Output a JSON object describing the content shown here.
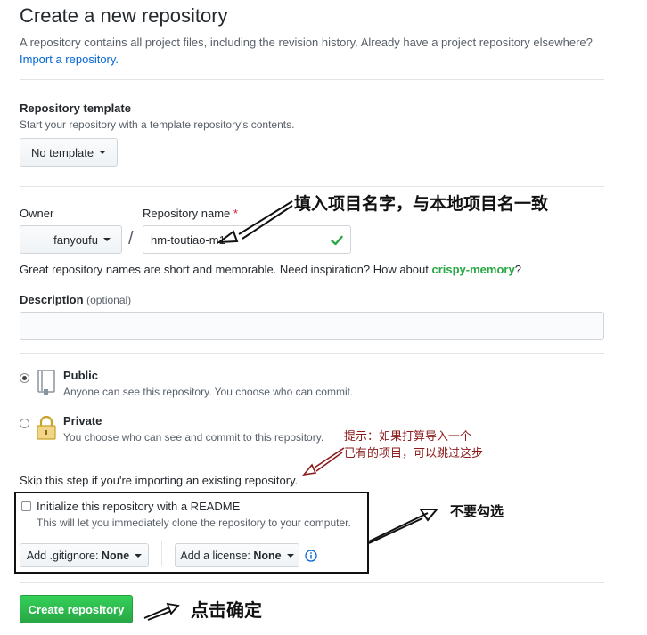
{
  "header": {
    "title": "Create a new repository",
    "subtitle": "A repository contains all project files, including the revision history. Already have a project repository elsewhere?",
    "import_link": "Import a repository."
  },
  "template": {
    "label": "Repository template",
    "hint": "Start your repository with a template repository's contents.",
    "button": "No template"
  },
  "owner": {
    "label": "Owner",
    "value": "fanyoufu",
    "separator": "/"
  },
  "repo_name": {
    "label": "Repository name",
    "required_mark": "*",
    "value": "hm-toutiao-m1",
    "suggestion_prefix": "Great repository names are short and memorable. Need inspiration? How about",
    "suggestion": "crispy-memory",
    "suggestion_suffix": "?"
  },
  "description": {
    "label": "Description",
    "optional": "(optional)",
    "value": ""
  },
  "visibility": {
    "public_title": "Public",
    "public_desc": "Anyone can see this repository. You choose who can commit.",
    "private_title": "Private",
    "private_desc": "You choose who can see and commit to this repository.",
    "selected": "public"
  },
  "init": {
    "skip_note": "Skip this step if you're importing an existing repository.",
    "readme_label": "Initialize this repository with a README",
    "readme_desc": "This will let you immediately clone the repository to your computer.",
    "readme_checked": false,
    "gitignore_label": "Add .gitignore:",
    "gitignore_value": "None",
    "license_label": "Add a license:",
    "license_value": "None"
  },
  "submit": {
    "label": "Create repository",
    "color": "#2ea44f"
  },
  "annotations": {
    "name_note": "填入项目名字，与本地项目名一致",
    "import_note_line1": "提示：如果打算导入一个",
    "import_note_line2": "已有的项目，可以跳过这步",
    "readme_note": "不要勾选",
    "create_note": "点击确定",
    "red_color": "#8b1a1a"
  }
}
